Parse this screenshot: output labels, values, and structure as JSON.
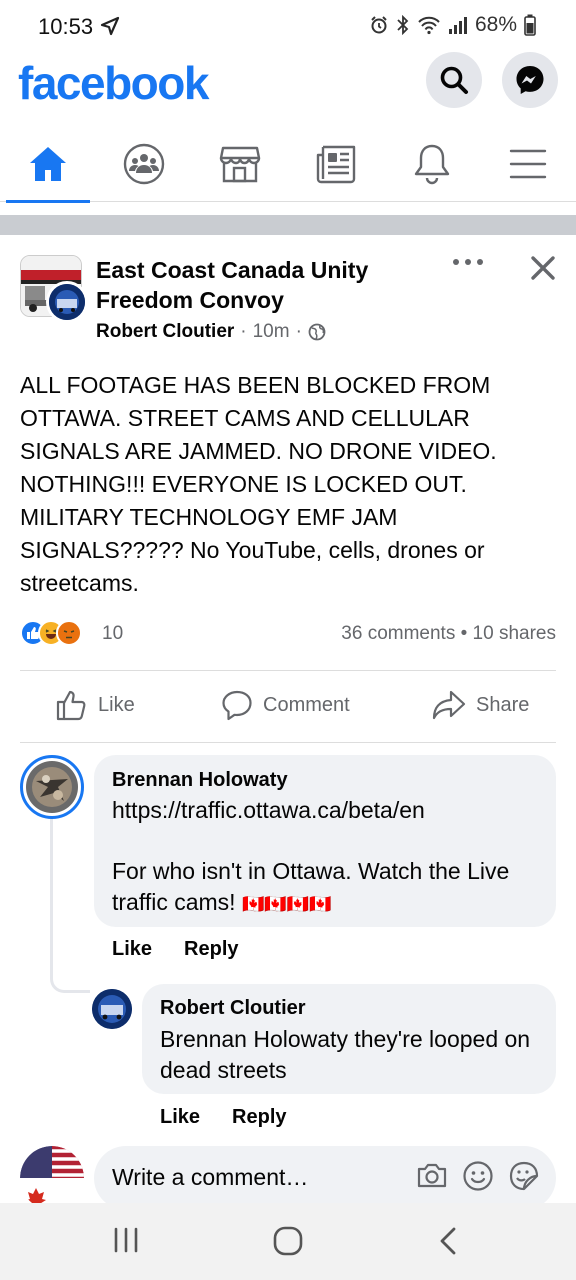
{
  "status_bar": {
    "time": "10:53",
    "battery": "68%"
  },
  "header": {
    "logo": "facebook",
    "search_icon": "search-icon",
    "messenger_icon": "messenger-icon"
  },
  "tabs": [
    {
      "name": "home",
      "icon": "home-icon",
      "active": true
    },
    {
      "name": "groups",
      "icon": "groups-icon",
      "active": false
    },
    {
      "name": "marketplace",
      "icon": "marketplace-icon",
      "active": false
    },
    {
      "name": "news",
      "icon": "news-icon",
      "active": false
    },
    {
      "name": "notifications",
      "icon": "bell-icon",
      "active": false
    },
    {
      "name": "menu",
      "icon": "menu-icon",
      "active": false
    }
  ],
  "post": {
    "group_name": "East Coast Canada Unity Freedom Convoy",
    "author": "Robert Cloutier",
    "time": "10m",
    "body": "ALL FOOTAGE HAS BEEN BLOCKED FROM OTTAWA. STREET CAMS AND CELLULAR SIGNALS ARE JAMMED. NO DRONE VIDEO. NOTHING!!!  EVERYONE IS LOCKED OUT. MILITARY TECHNOLOGY EMF JAM SIGNALS????? No YouTube, cells, drones or streetcams.",
    "reaction_count": "10",
    "comments": "36 comments",
    "shares": "10 shares",
    "actions": {
      "like": "Like",
      "comment": "Comment",
      "share": "Share"
    }
  },
  "comments": [
    {
      "name": "Brennan Holowaty",
      "text_line1": "https://traffic.ottawa.ca/beta/en",
      "text_line2": "For who isn't in Ottawa. Watch the Live traffic cams!",
      "flags": "🇨🇦🇨🇦🇨🇦🇨🇦",
      "like": "Like",
      "reply": "Reply"
    },
    {
      "name": "Robert Cloutier",
      "text": "Brennan Holowaty they're looped on dead streets",
      "like": "Like",
      "reply": "Reply"
    }
  ],
  "write_comment": {
    "placeholder": "Write a comment…"
  },
  "colors": {
    "brand": "#1877f2",
    "muted": "#65676b",
    "bubble": "#f0f2f5"
  }
}
